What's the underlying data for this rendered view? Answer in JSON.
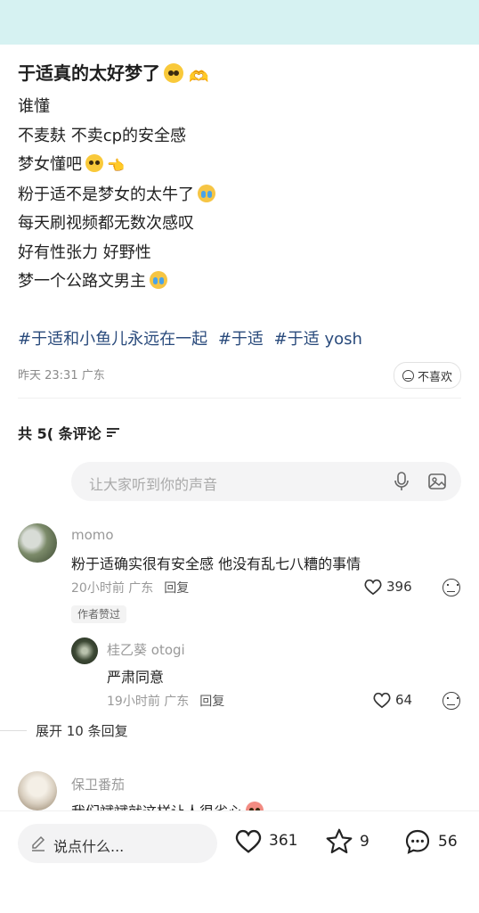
{
  "post": {
    "title": "于适真的太好梦了",
    "lines": [
      "谁懂",
      "不麦麸 不卖cp的安全感",
      "梦女懂吧",
      "粉于适不是梦女的太牛了",
      "每天刷视频都无数次感叹",
      "好有性张力 好野性",
      "梦一个公路文男主"
    ],
    "tags": [
      "#于适和小鱼儿永远在一起",
      "#于适",
      "#于适 yosh"
    ],
    "meta": "昨天 23:31 广东",
    "dislike_label": "不喜欢"
  },
  "comments_header": {
    "label": "共 5( 条评论"
  },
  "comment_input": {
    "placeholder": "让大家听到你的声音"
  },
  "comments": [
    {
      "name": "momo",
      "text": "粉于适确实很有安全感   他没有乱七八糟的事情",
      "time": "20小时前 广东",
      "reply": "回复",
      "likes": "396",
      "badge": "作者赞过"
    },
    {
      "name": "桂乙葵 otogi",
      "text": "严肃同意",
      "time": "19小时前 广东",
      "reply": "回复",
      "likes": "64"
    },
    {
      "name": "保卫番茄",
      "text": "我们斌斌就这样让人很省心"
    }
  ],
  "expand_label": "展开 10 条回复",
  "bottom": {
    "input_placeholder": "说点什么...",
    "likes": "361",
    "stars": "9",
    "comments": "56"
  },
  "colors": {
    "topbar": "#d6f2f2",
    "tag": "#2a4b7c"
  },
  "icons": [
    "heart-icon",
    "star-icon",
    "comment-bubble-icon",
    "mic-icon",
    "image-icon",
    "pencil-icon",
    "dislike-face-icon",
    "sort-icon"
  ]
}
